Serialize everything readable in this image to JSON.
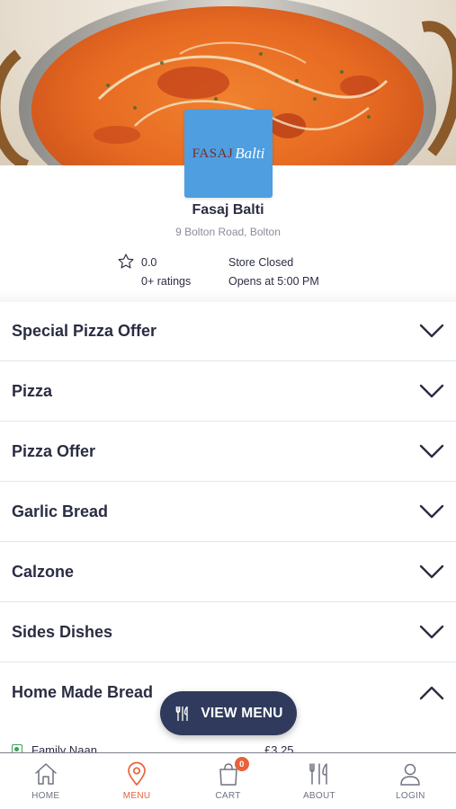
{
  "store": {
    "logo_text_a": "FASAJ",
    "logo_text_b": "Balti",
    "name": "Fasaj Balti",
    "address": "9 Bolton Road, Bolton",
    "rating_value": "0.0",
    "rating_count": "0+ ratings",
    "status": "Store Closed",
    "opens": "Opens at 5:00 PM"
  },
  "categories": [
    {
      "label": "Special Pizza Offer",
      "expanded": false
    },
    {
      "label": "Pizza",
      "expanded": false
    },
    {
      "label": "Pizza Offer",
      "expanded": false
    },
    {
      "label": "Garlic Bread",
      "expanded": false
    },
    {
      "label": "Calzone",
      "expanded": false
    },
    {
      "label": "Sides Dishes",
      "expanded": false
    },
    {
      "label": "Home Made Bread",
      "expanded": true
    }
  ],
  "peek_item": {
    "name": "Family Naan",
    "price": "£3.25"
  },
  "view_menu_button": {
    "label": "VIEW MENU",
    "icon": "cutlery-icon"
  },
  "nav": {
    "items": [
      {
        "label": "HOME",
        "icon": "home-icon"
      },
      {
        "label": "MENU",
        "icon": "map-pin-icon",
        "active": true
      },
      {
        "label": "CART",
        "icon": "shopping-bag-icon",
        "badge": "0"
      },
      {
        "label": "ABOUT",
        "icon": "cutlery-icon"
      },
      {
        "label": "LOGIN",
        "icon": "user-icon"
      }
    ]
  },
  "colors": {
    "accent": "#e8623a",
    "dark": "#2f3a5c",
    "text": "#2b2d42",
    "logo_bg": "#4e9ee0"
  }
}
